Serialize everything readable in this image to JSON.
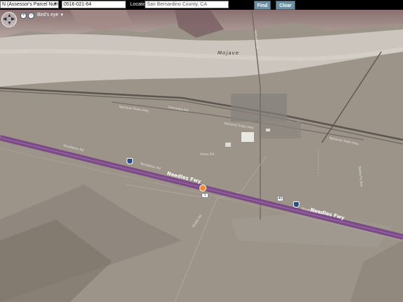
{
  "toolbar": {
    "search_type": "N (Assessor's Parcel Number)",
    "parcel_number": "0516-021-64",
    "location_label": "Location:",
    "location_value": "San Bernardino County, CA",
    "find_label": "Find",
    "clear_label": "Clear"
  },
  "map": {
    "view_mode": "Bird's eye",
    "labels": {
      "mojave": "Mojave",
      "needles_fwy_1": "Needles Fwy",
      "needles_fwy_2": "Needles Fwy",
      "national_trails_1": "National Trails Hwy",
      "national_trails_2": "National Trails Hwy",
      "national_trails_3": "National Trails Hwy",
      "pendleton_1": "Pendleton Rd",
      "pendleton_2": "Pendleton Rd",
      "pendleton_3": "Pendleton Rd",
      "amos_rd": "Amos Rd",
      "fortunato": "Fortunato Rd",
      "kelbaker": "Kelbaker Rd",
      "santa_fe": "Santa Fe Ave",
      "drake": "Drake Rd"
    },
    "shield_40": "40",
    "marker_label": "1"
  },
  "colors": {
    "freeway": "#7b4a87",
    "marker": "#f08c26",
    "button": "#6c8fa1",
    "terrain": "#9a9186",
    "wash": "#c9c4bc"
  }
}
